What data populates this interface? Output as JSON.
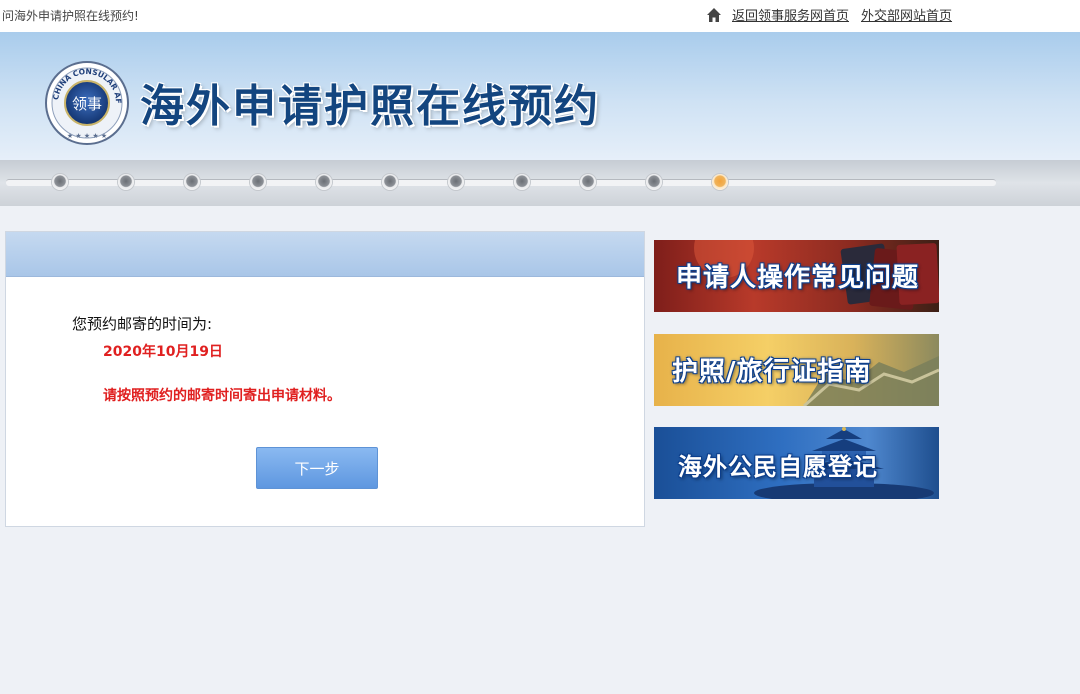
{
  "header": {
    "welcome": "问海外申请护照在线预约!",
    "links": [
      "返回领事服务网首页",
      "外交部网站首页"
    ],
    "icons": {
      "home": "home-icon"
    }
  },
  "banner": {
    "title": "海外申请护照在线预约",
    "seal_text": "CHINA CONSULAR AFFAIRS",
    "seal_center": "领事",
    "seal_icon": "consular-seal-logo"
  },
  "progress": {
    "total_steps": 11,
    "current_step": 11,
    "active_color": "#f3a33a"
  },
  "main": {
    "label": "您预约邮寄的时间为:",
    "date": "2020年10月19日",
    "note": "请按照预约的邮寄时间寄出申请材料。",
    "next_button": "下一步",
    "accent_color": "#e02020"
  },
  "sidebar": {
    "banners": [
      {
        "label": "申请人操作常见问题"
      },
      {
        "label": "护照/旅行证指南"
      },
      {
        "label": "海外公民自愿登记"
      }
    ]
  }
}
